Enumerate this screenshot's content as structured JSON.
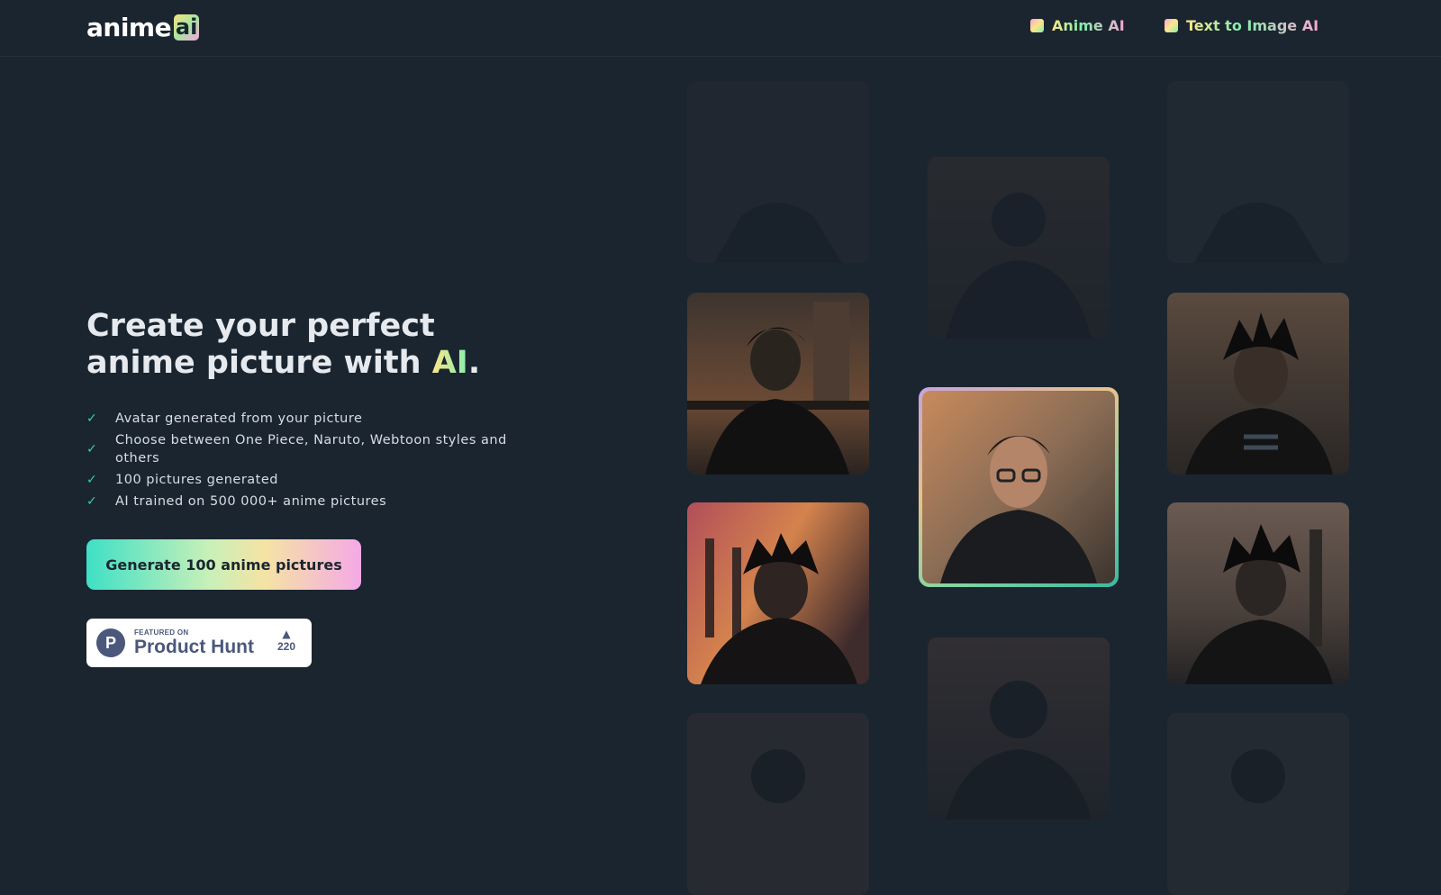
{
  "header": {
    "logo_text": "anime",
    "logo_badge": "ai",
    "nav": [
      {
        "label": "Anime AI"
      },
      {
        "label": "Text to Image AI"
      }
    ]
  },
  "hero": {
    "headline_line1": "Create your perfect",
    "headline_line2_prefix": "anime picture with ",
    "headline_highlight": "AI",
    "headline_suffix": ".",
    "features": [
      "Avatar generated from your picture",
      "Choose between One Piece, Naruto, Webtoon styles and others",
      "100 pictures generated",
      "AI trained on 500 000+ anime pictures"
    ],
    "cta_label": "Generate 100 anime pictures"
  },
  "product_hunt": {
    "logo_letter": "P",
    "small_label": "FEATURED ON",
    "big_label": "Product Hunt",
    "votes": "220"
  },
  "gallery": {
    "featured_alt": "original photo of a man with glasses"
  }
}
